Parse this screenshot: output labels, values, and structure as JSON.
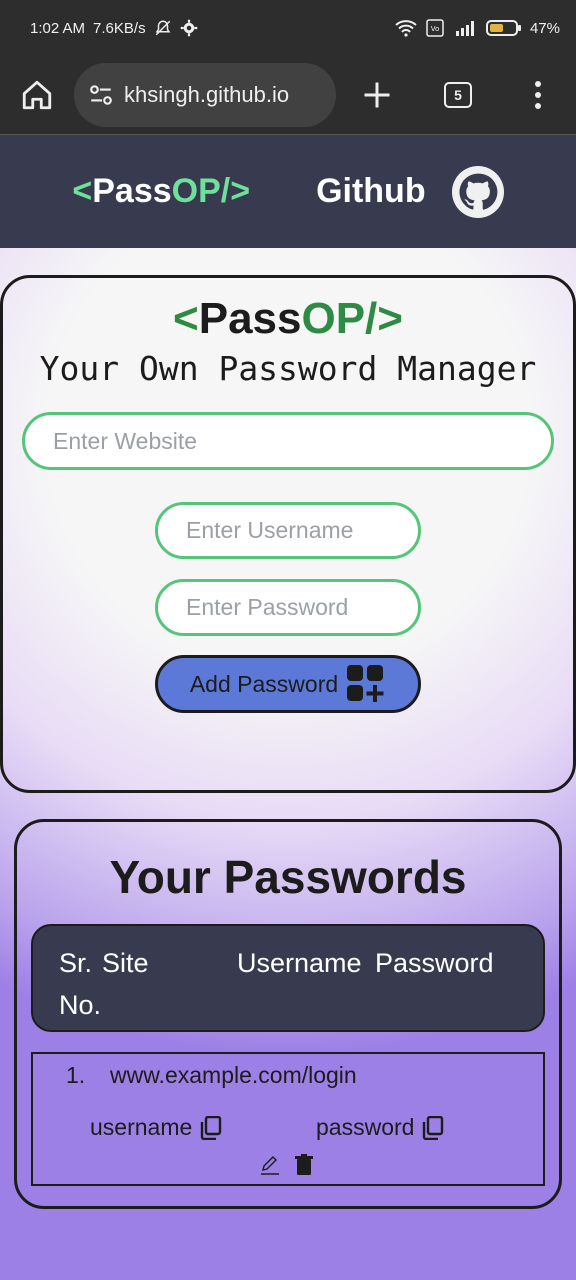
{
  "status_bar": {
    "time": "1:02 AM",
    "speed": "7.6KB/s",
    "battery": "47%"
  },
  "browser": {
    "url": "khsingh.github.io",
    "tab_count": "5"
  },
  "navbar": {
    "logo_open": "<",
    "logo_pass": "Pass",
    "logo_op": "OP/>",
    "github_label": "Github"
  },
  "form": {
    "logo_open": "<",
    "logo_pass": "Pass",
    "logo_op": "OP/>",
    "subtitle": "Your Own Password Manager",
    "website_placeholder": "Enter Website",
    "username_placeholder": "Enter Username",
    "password_placeholder": "Enter Password",
    "add_button_label": "Add Password"
  },
  "passwords": {
    "title": "Your Passwords",
    "headers": {
      "sr_line1": "Sr.",
      "sr_line2": "No.",
      "site": "Site",
      "username": "Username",
      "password": "Password"
    },
    "rows": [
      {
        "sr": "1.",
        "site": "www.example.com/login",
        "username": "username",
        "password": "password"
      }
    ]
  },
  "colors": {
    "navbar_bg": "#383b4f",
    "accent_green": "#55c57a",
    "button_blue": "#5c79d8"
  }
}
